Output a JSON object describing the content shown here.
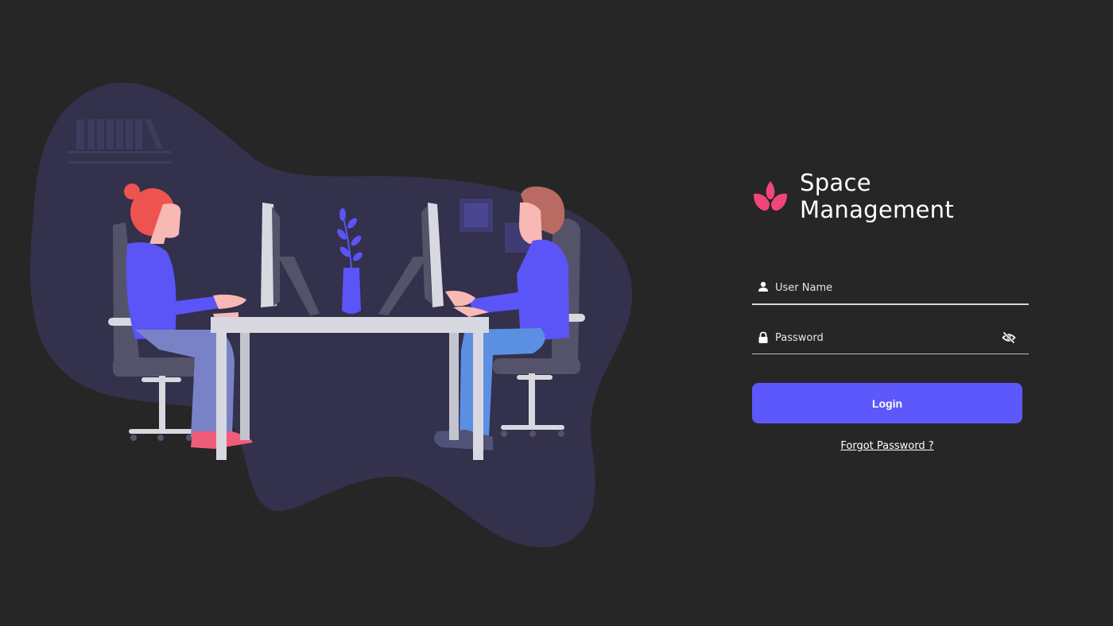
{
  "brand": {
    "title": "Space Management",
    "logo_icon": "lotus-icon",
    "logo_color": "#f2457c"
  },
  "form": {
    "username": {
      "placeholder": "User Name",
      "value": "",
      "icon": "user-icon"
    },
    "password": {
      "placeholder": "Password",
      "value": "",
      "icon": "lock-icon",
      "toggle_icon": "eye-off-icon"
    },
    "login_label": "Login",
    "forgot_label": "Forgot Password ?"
  },
  "colors": {
    "background": "#262626",
    "accent": "#5c58fb",
    "blob": "#33314b",
    "brand": "#f2457c"
  }
}
